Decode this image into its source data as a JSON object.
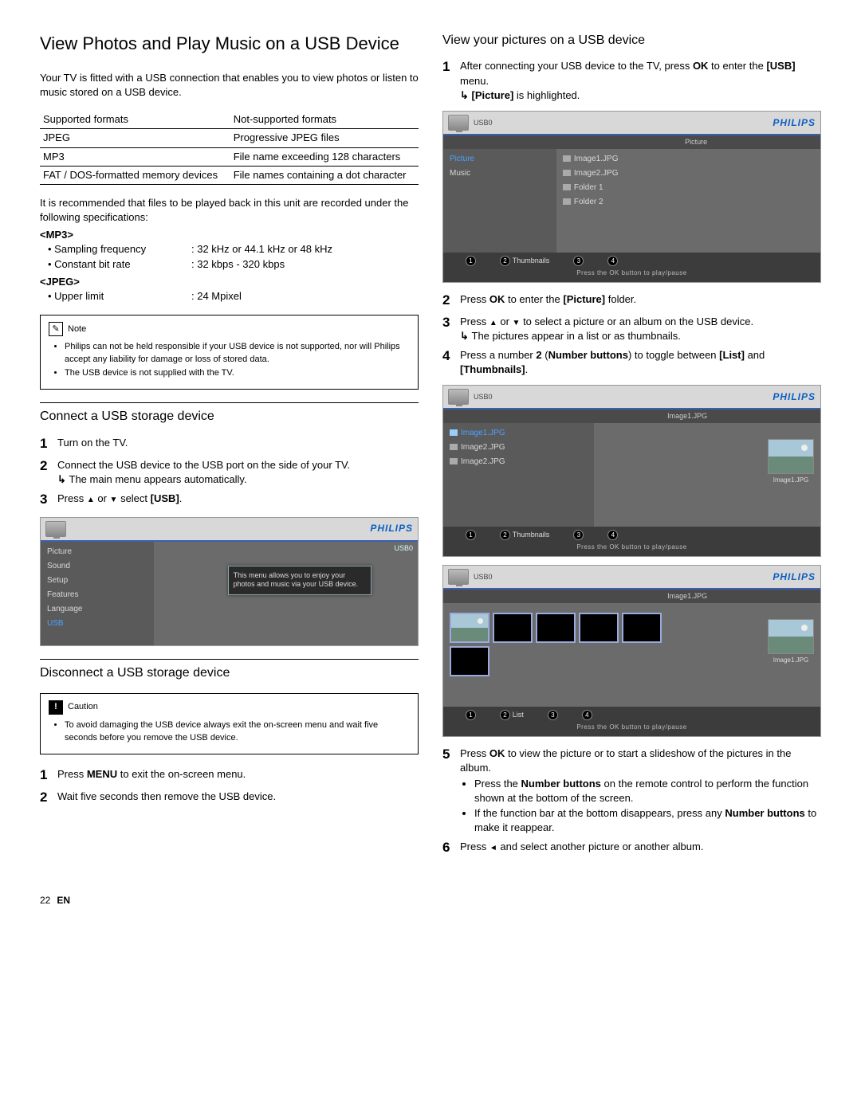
{
  "title": "View Photos and Play Music on a USB Device",
  "intro": "Your TV is fitted with a USB connection that enables you to view photos or listen to music stored on a USB device.",
  "formats": {
    "h1": "Supported formats",
    "h2": "Not-supported formats",
    "rows": [
      [
        "JPEG",
        "Progressive JPEG files"
      ],
      [
        "MP3",
        "File name exceeding 128 characters"
      ],
      [
        "FAT / DOS-formatted memory devices",
        "File names containing a dot character"
      ]
    ]
  },
  "specnote": "It is recommended that files to be played back in this unit are recorded under the following specifications:",
  "mp3label": "<MP3>",
  "mp3specs": [
    {
      "k": "Sampling frequency",
      "v": ": 32 kHz or 44.1 kHz or 48 kHz"
    },
    {
      "k": "Constant bit rate",
      "v": ": 32 kbps - 320 kbps"
    }
  ],
  "jpeglabel": "<JPEG>",
  "jpegspecs": [
    {
      "k": "Upper limit",
      "v": ": 24 Mpixel"
    }
  ],
  "note": {
    "title": "Note",
    "items": [
      "Philips can not be held responsible if your USB device is not supported, nor will Philips accept any liability for damage or loss of stored data.",
      "The USB device is not supplied with the TV."
    ]
  },
  "connect": {
    "title": "Connect a USB storage device",
    "steps": {
      "s1": "Turn on the TV.",
      "s2": "Connect the USB device to the USB port on the side of your TV.",
      "s2sub": "The main menu appears automatically.",
      "s3a": "Press ",
      "s3b": " or ",
      "s3c": " select ",
      "s3usb": "USB",
      "s3d": "."
    }
  },
  "disconnect": {
    "title": "Disconnect a USB storage device",
    "caution": {
      "title": "Caution",
      "items": [
        "To avoid damaging the USB device always exit the on-screen menu and wait five seconds before you remove the USB device."
      ]
    },
    "steps": {
      "s1a": "Press ",
      "s1b": "MENU",
      "s1c": " to exit the on-screen menu.",
      "s2": "Wait five seconds then remove the USB device."
    }
  },
  "view": {
    "title": "View your pictures on a USB device",
    "s1a": "After connecting your USB device to the TV, press ",
    "s1ok": "OK",
    "s1b": " to enter the ",
    "s1usb": "USB",
    "s1c": " menu.",
    "s1sub_a": "",
    "s1sub_pic": "Picture",
    "s1sub_b": " is highlighted.",
    "s2a": "Press ",
    "s2ok": "OK",
    "s2b": " to enter the ",
    "s2pic": "Picture",
    "s2c": " folder.",
    "s3a": "Press ",
    "s3b": " or ",
    "s3c": " to select a picture or an album on the USB device.",
    "s3sub": "The pictures appear in a list or as thumbnails.",
    "s4a": "Press a number ",
    "s4n": "2",
    "s4b": " (",
    "s4nb": "Number buttons",
    "s4c": ") to toggle between ",
    "s4list": "List",
    "s4d": " and ",
    "s4th": "Thumbnails",
    "s4e": ".",
    "s5a": "Press ",
    "s5ok": "OK",
    "s5b": " to view the picture or to start a slideshow of the pictures in the album.",
    "s5sub1a": "Press the ",
    "s5sub1b": "Number buttons",
    "s5sub1c": " on the remote control to perform the function shown at the bottom of the screen.",
    "s5sub2a": "If the function bar at the bottom disappears, press any ",
    "s5sub2b": "Number buttons",
    "s5sub2c": " to make it reappear.",
    "s6a": "Press ",
    "s6b": " and select another picture or another album."
  },
  "tv": {
    "brand": "PHILIPS",
    "press": "Press the OK button to play/pause",
    "thumbnails": "Thumbnails",
    "list": "List",
    "usb0": "USB0",
    "menu1": {
      "left": [
        "Picture",
        "Sound",
        "Setup",
        "Features",
        "Language",
        "USB"
      ],
      "selected": "USB",
      "right_label": "USB0",
      "tooltip": "This menu allows you to enjoy your photos and music via your USB device."
    },
    "menu2": {
      "crumb": "Picture",
      "left": [
        "Picture",
        "Music"
      ],
      "selected": "Picture",
      "right": [
        "Image1.JPG",
        "Image2.JPG",
        "Folder 1",
        "Folder 2"
      ]
    },
    "menu3": {
      "crumb": "Image1.JPG",
      "left": [
        "Image1.JPG",
        "Image2.JPG",
        "Image2.JPG"
      ],
      "selected": "Image1.JPG",
      "preview": "Image1.JPG"
    },
    "menu4": {
      "crumb": "Image1.JPG",
      "preview": "Image1.JPG"
    }
  },
  "footer": {
    "page": "22",
    "lang": "EN"
  }
}
